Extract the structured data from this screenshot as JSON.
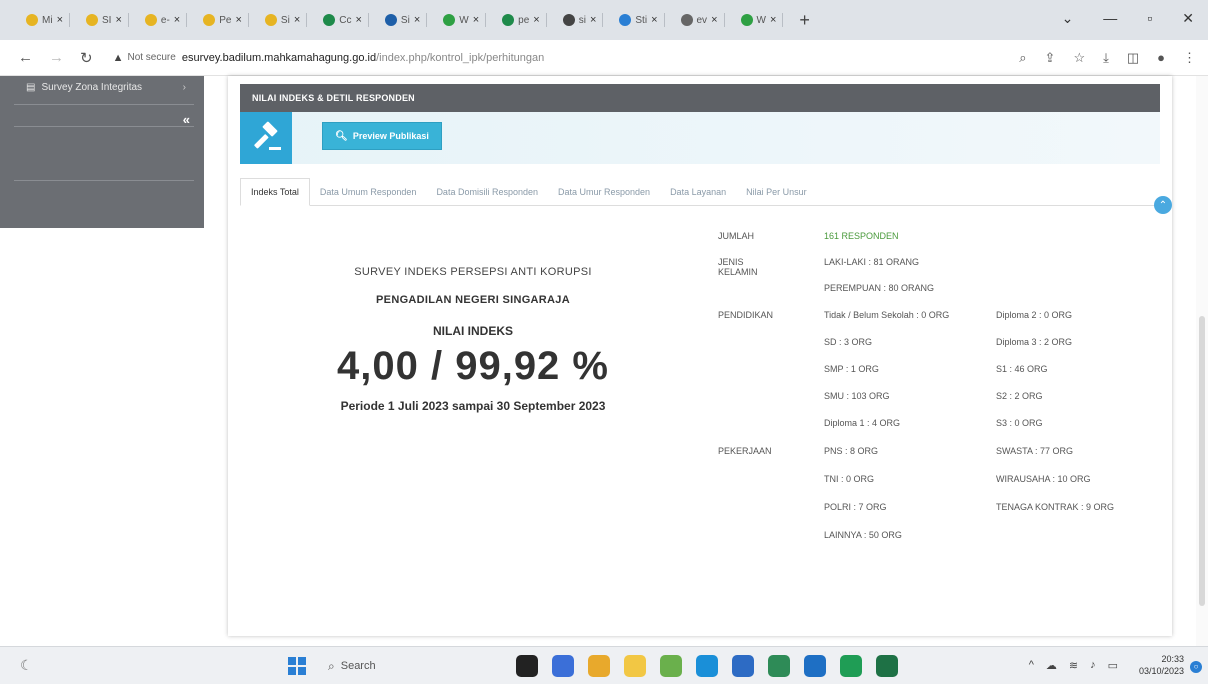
{
  "browser": {
    "tabs": [
      {
        "label": "Mi",
        "color": "#e6b422"
      },
      {
        "label": "SI",
        "color": "#e6b422"
      },
      {
        "label": "e-",
        "color": "#e6b422"
      },
      {
        "label": "Pe",
        "color": "#e6b422"
      },
      {
        "label": "Si",
        "color": "#e6b422"
      },
      {
        "label": "Cc",
        "color": "#1e8a4a"
      },
      {
        "label": "Si",
        "color": "#1e5fa8"
      },
      {
        "label": "W",
        "color": "#2ea043"
      },
      {
        "label": "pe",
        "color": "#1e8a4a"
      },
      {
        "label": "si",
        "color": "#444444"
      },
      {
        "label": "Sti",
        "color": "#2a7fd4"
      },
      {
        "label": "ev",
        "color": "#666666"
      },
      {
        "label": "W",
        "color": "#2ea043"
      }
    ],
    "new_tab": "+",
    "secure_label": "Not secure",
    "url_host": "esurvey.badilum.mahkamahagung.go.id",
    "url_path": "/index.php/kontrol_ipk/perhitungan"
  },
  "sidebar": {
    "item": "Survey Zona Integritas",
    "collapse": "«"
  },
  "panel": {
    "header": "NILAI INDEKS & DETIL RESPONDEN",
    "preview_button": "Preview Publikasi",
    "tabs": [
      "Indeks Total",
      "Data Umum Responden",
      "Data Domisili Responden",
      "Data Umur Responden",
      "Data Layanan",
      "Nilai Per Unsur"
    ]
  },
  "summary": {
    "title": "SURVEY INDEKS PERSEPSI ANTI KORUPSI",
    "court": "PENGADILAN NEGERI SINGARAJA",
    "label": "NILAI INDEKS",
    "value": "4,00 / 99,92 %",
    "period": "Periode 1 Juli 2023 sampai 30 September 2023"
  },
  "stats": {
    "jumlah_label": "JUMLAH",
    "jumlah_value": "161 RESPONDEN",
    "gender_label": "JENIS KELAMIN",
    "gender": [
      "LAKI-LAKI : 81 ORANG",
      "PEREMPUAN : 80 ORANG"
    ],
    "edu_label": "PENDIDIKAN",
    "edu_col1": [
      "Tidak / Belum Sekolah : 0 ORG",
      "SD : 3 ORG",
      "SMP : 1 ORG",
      "SMU : 103 ORG",
      "Diploma 1 : 4 ORG"
    ],
    "edu_col2": [
      "Diploma 2 : 0 ORG",
      "Diploma 3 : 2 ORG",
      "S1 : 46 ORG",
      "S2 : 2 ORG",
      "S3 : 0 ORG"
    ],
    "job_label": "PEKERJAAN",
    "job_col1": [
      "PNS : 8 ORG",
      "TNI : 0 ORG",
      "POLRI : 7 ORG",
      "LAINNYA : 50 ORG"
    ],
    "job_col2": [
      "SWASTA : 77 ORG",
      "WIRAUSAHA : 10 ORG",
      "TENAGA KONTRAK : 9 ORG"
    ]
  },
  "taskbar": {
    "search": "Search",
    "time": "20:33",
    "date": "03/10/2023"
  }
}
